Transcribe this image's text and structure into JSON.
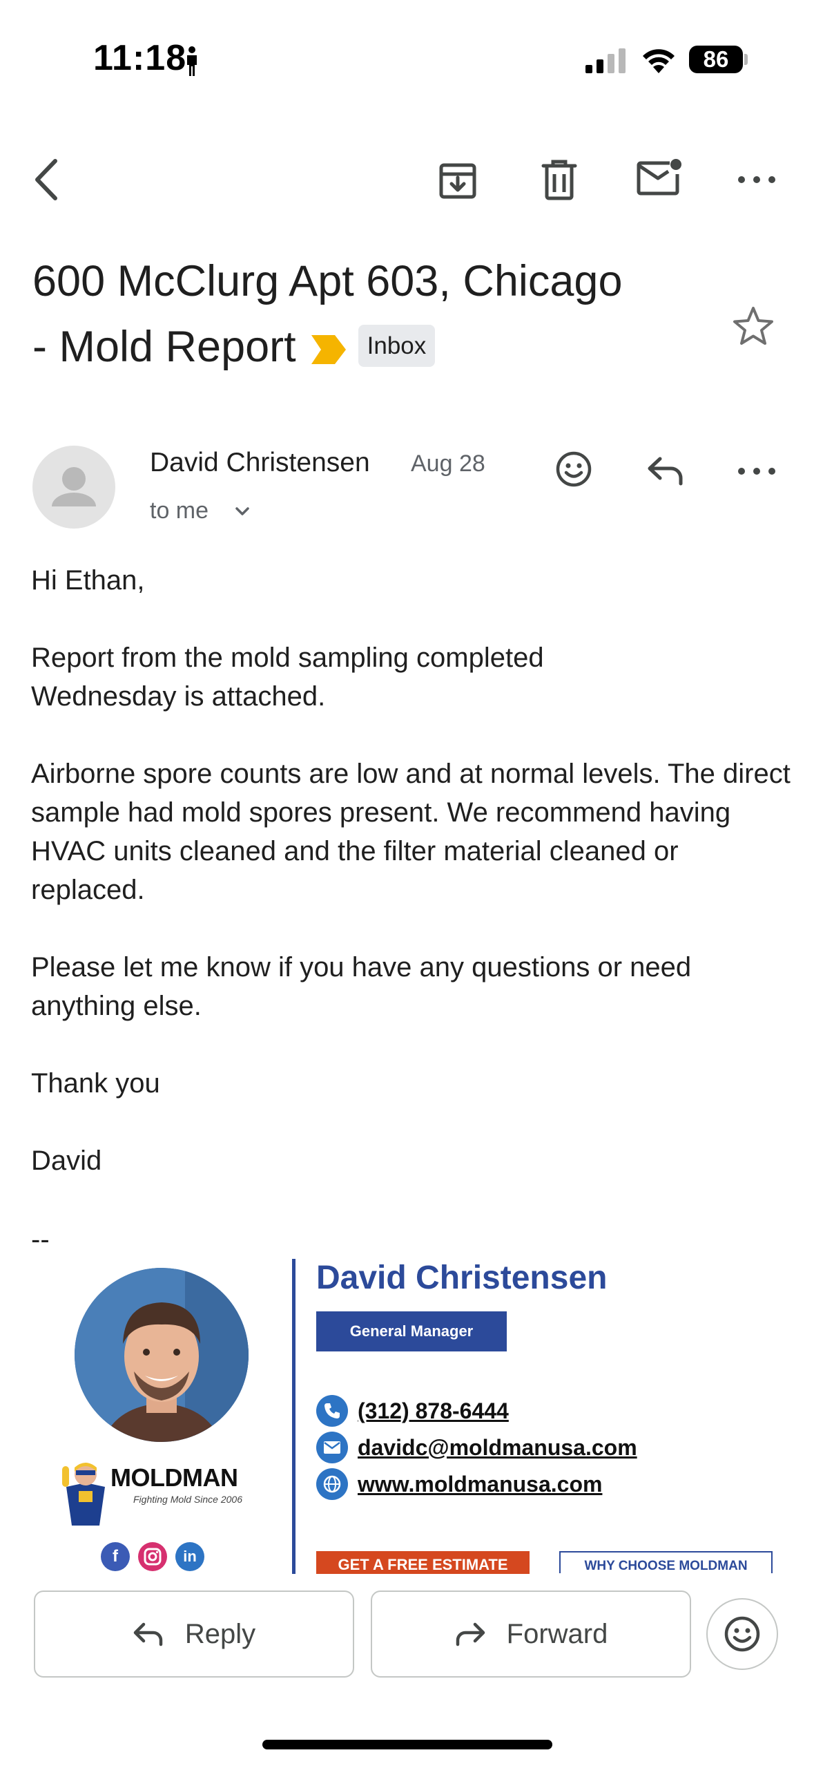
{
  "status_bar": {
    "time": "11:18",
    "battery": "86"
  },
  "subject": {
    "line1": "600 McClurg Apt 603, Chicago",
    "line2": "- Mold Report",
    "label": "Inbox"
  },
  "sender": {
    "name": "David Christensen",
    "date": "Aug 28",
    "recipient": "to me"
  },
  "body": {
    "greeting": "Hi Ethan,",
    "p1": "Report from the mold sampling completed Wednesday is attached.",
    "p2": "Airborne spore counts are low and at normal levels. The direct sample had mold spores present. We recommend having HVAC units cleaned and the filter material cleaned or replaced.",
    "p3": "Please let me know if you have any questions or need anything else.",
    "thanks": "Thank you",
    "signoff": "David",
    "separator": "--"
  },
  "signature": {
    "name": "David Christensen",
    "title": "General Manager",
    "phone": "(312) 878-6444",
    "email": "davidc@moldmanusa.com",
    "website": "www.moldmanusa.com",
    "logo_text": "MOLDMAN",
    "tagline": "Fighting Mold Since 2006",
    "estimate_button": "GET A FREE ESTIMATE",
    "why_button": "WHY CHOOSE MOLDMAN",
    "brand_color": "#2c4a9a",
    "accent_color": "#d5481f",
    "social_icons": [
      "facebook-icon",
      "instagram-icon",
      "linkedin-icon"
    ]
  },
  "actions": {
    "reply": "Reply",
    "forward": "Forward"
  },
  "colors": {
    "important_marker": "#f5b400",
    "icon_gray": "#444746"
  }
}
